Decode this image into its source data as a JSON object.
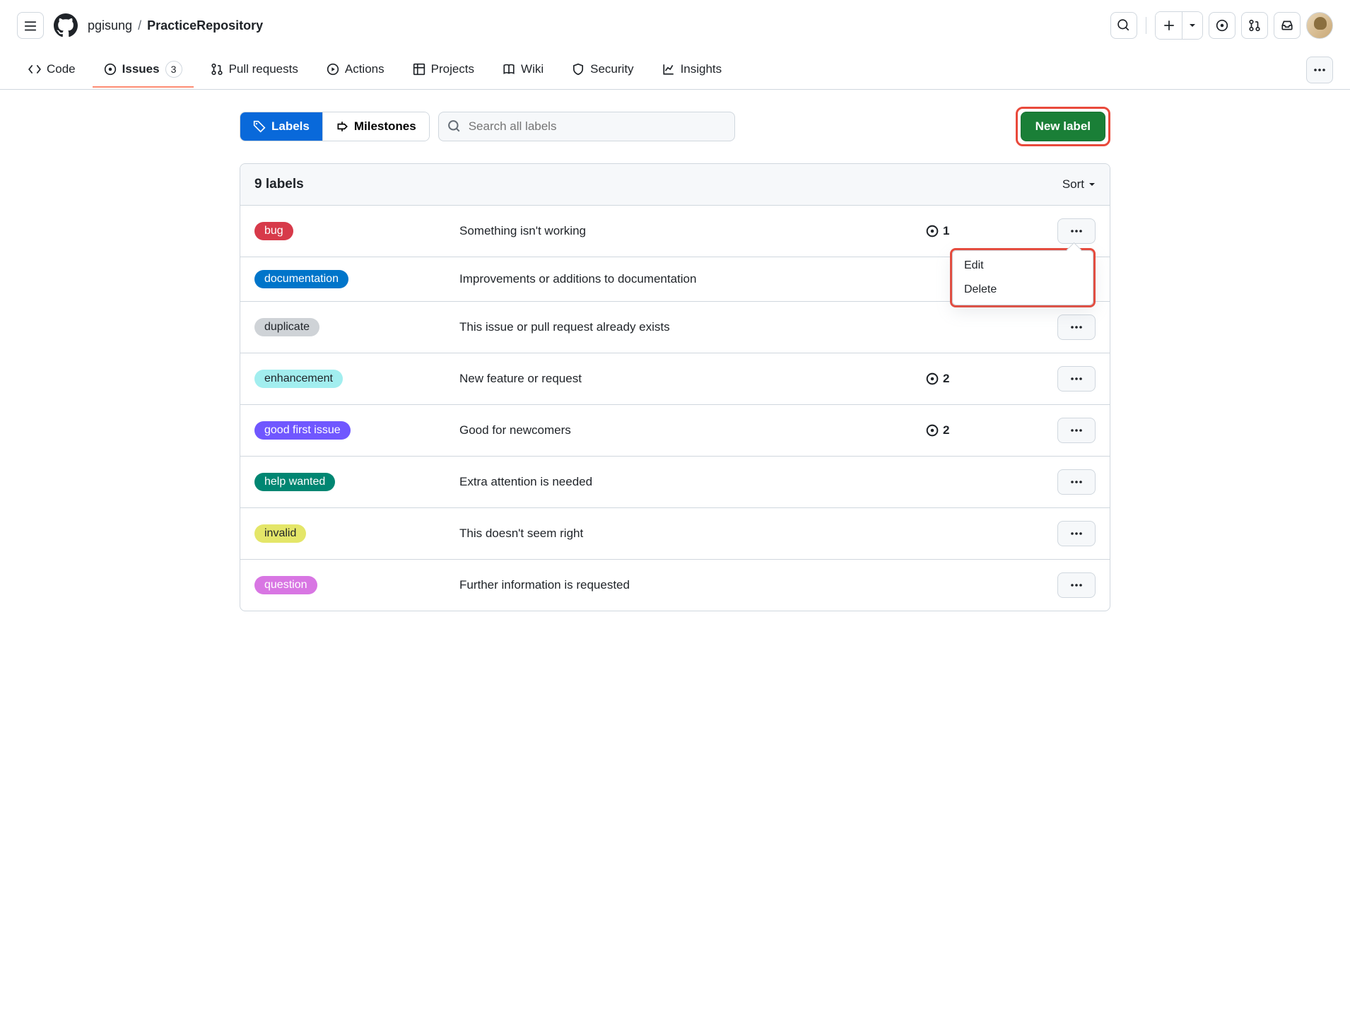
{
  "breadcrumb": {
    "owner": "pgisung",
    "sep": "/",
    "repo": "PracticeRepository"
  },
  "repo_nav": {
    "code": "Code",
    "issues": "Issues",
    "issues_count": "3",
    "pulls": "Pull requests",
    "actions": "Actions",
    "projects": "Projects",
    "wiki": "Wiki",
    "security": "Security",
    "insights": "Insights"
  },
  "filters": {
    "labels": "Labels",
    "milestones": "Milestones",
    "search_placeholder": "Search all labels"
  },
  "new_label": "New label",
  "panel": {
    "title": "9 labels",
    "sort": "Sort"
  },
  "dropdown": {
    "edit": "Edit",
    "delete": "Delete"
  },
  "labels": [
    {
      "name": "bug",
      "desc": "Something isn't working",
      "count": "1",
      "bg": "#d73a4a",
      "fg": "#ffffff"
    },
    {
      "name": "documentation",
      "desc": "Improvements or additions to documentation",
      "count": "",
      "bg": "#0075ca",
      "fg": "#ffffff"
    },
    {
      "name": "duplicate",
      "desc": "This issue or pull request already exists",
      "count": "",
      "bg": "#cfd3d7",
      "fg": "#1f2328"
    },
    {
      "name": "enhancement",
      "desc": "New feature or request",
      "count": "2",
      "bg": "#a2eeef",
      "fg": "#1f2328"
    },
    {
      "name": "good first issue",
      "desc": "Good for newcomers",
      "count": "2",
      "bg": "#7057ff",
      "fg": "#ffffff"
    },
    {
      "name": "help wanted",
      "desc": "Extra attention is needed",
      "count": "",
      "bg": "#008672",
      "fg": "#ffffff"
    },
    {
      "name": "invalid",
      "desc": "This doesn't seem right",
      "count": "",
      "bg": "#e4e669",
      "fg": "#1f2328"
    },
    {
      "name": "question",
      "desc": "Further information is requested",
      "count": "",
      "bg": "#d876e3",
      "fg": "#ffffff"
    }
  ]
}
